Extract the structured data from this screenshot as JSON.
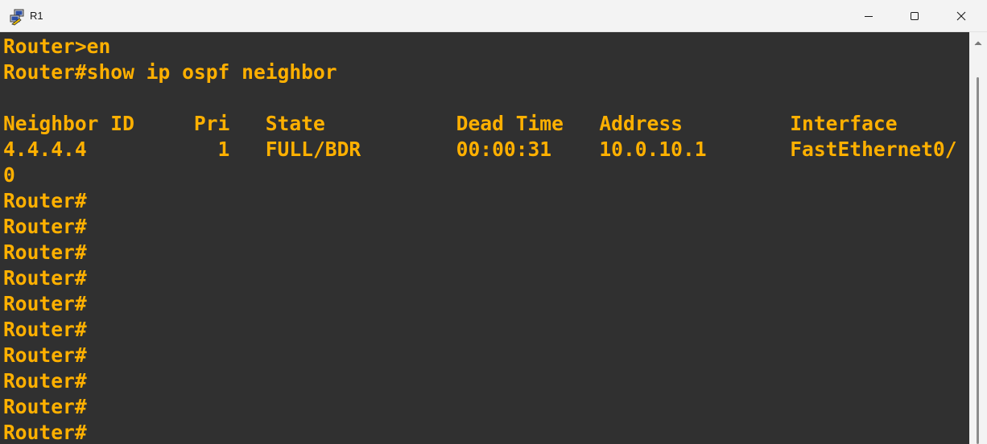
{
  "window": {
    "title": "R1",
    "app_icon": "putty-icon",
    "controls": [
      "minimize-icon",
      "maximize-icon",
      "close-icon"
    ]
  },
  "terminal": {
    "text_color": "#ffb000",
    "background": "#303030",
    "lines": [
      "Router>en",
      "Router#show ip ospf neighbor",
      "",
      "Neighbor ID     Pri   State           Dead Time   Address         Interface",
      "4.4.4.4           1   FULL/BDR        00:00:31    10.0.10.1       FastEthernet0/",
      "0",
      "Router#",
      "Router#",
      "Router#",
      "Router#",
      "Router#",
      "Router#",
      "Router#",
      "Router#",
      "Router#",
      "Router#"
    ]
  },
  "scrollbar": {
    "up_icon": "chevron-up-icon"
  }
}
